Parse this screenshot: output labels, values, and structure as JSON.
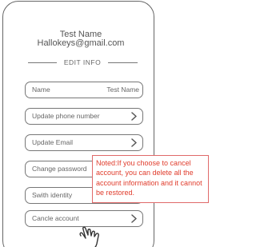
{
  "profile": {
    "name": "Test Name",
    "email": "Hallokeys@gmail.com"
  },
  "section": {
    "title": "EDIT INFO"
  },
  "rows": [
    {
      "label": "Name",
      "value": "Test Name"
    },
    {
      "label": "Update phone number",
      "icon": "chevron-right-icon"
    },
    {
      "label": "Update Email",
      "icon": "chevron-right-icon"
    },
    {
      "label": "Change password"
    },
    {
      "label": "Swith identity"
    },
    {
      "label": "Cancle account",
      "icon": "chevron-right-icon"
    }
  ],
  "note": {
    "text": "Noted:If you choose to cancel account, you can delete all the account information and it cannot be restored."
  },
  "colors": {
    "note_text": "#e03c2c",
    "note_border": "#e06a6a",
    "outline": "#777777"
  },
  "icons": {
    "pointer": "hand-pointer-icon"
  }
}
